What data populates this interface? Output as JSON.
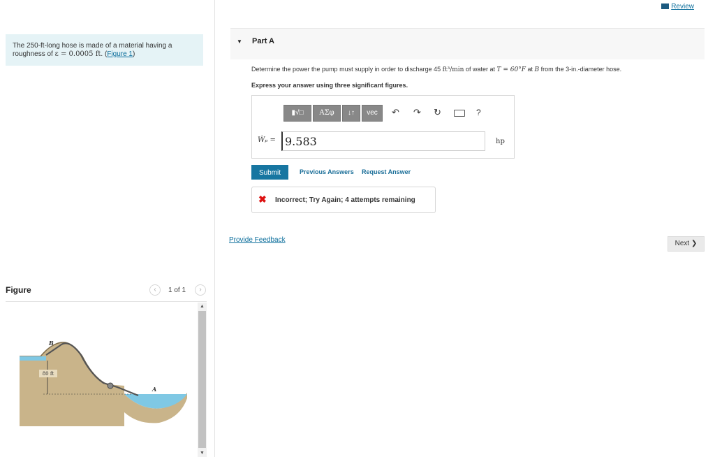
{
  "header": {
    "review_label": "Review"
  },
  "problem": {
    "text_before": "The 250-ft-long hose is made of a material having a roughness of ",
    "epsilon_expr": "ε = 0.0005 ft",
    "text_after": ". (",
    "figure_link": "Figure 1",
    "close_paren": ")"
  },
  "figure": {
    "title": "Figure",
    "counter": "1 of 1",
    "prev_icon": "‹",
    "next_icon": "›",
    "labels": {
      "point_b": "B",
      "point_a": "A",
      "height": "80 ft"
    }
  },
  "part": {
    "arrow_icon": "▼",
    "title": "Part A",
    "question_1": "Determine the power the pump must supply in order to discharge 45 ",
    "question_unit": "ft³/min",
    "question_2": " of water at ",
    "question_temp": "T = 60°F",
    "question_3": " at ",
    "question_point": "B",
    "question_4": " from the 3-in.-diameter hose.",
    "instruction": "Express your answer using three significant figures."
  },
  "toolbar": {
    "template_label": "▮√□",
    "greek_label": "ΑΣφ",
    "arrows_label": "↓↑",
    "vec_label": "vec",
    "undo_icon": "↶",
    "redo_icon": "↷",
    "reset_icon": "↻",
    "help_label": "?"
  },
  "answer": {
    "variable": "Ẇₚ =",
    "value": "9.583",
    "unit": "hp"
  },
  "actions": {
    "submit": "Submit",
    "previous_answers": "Previous Answers",
    "request_answer": "Request Answer"
  },
  "feedback": {
    "icon": "✖",
    "message": "Incorrect; Try Again; 4 attempts remaining"
  },
  "footer": {
    "provide_feedback": "Provide Feedback",
    "next": "Next ❯"
  },
  "colors": {
    "accent": "#1776a1",
    "problem_bg": "#e5f3f6",
    "error": "#d11111",
    "water": "#7fc8e4"
  }
}
